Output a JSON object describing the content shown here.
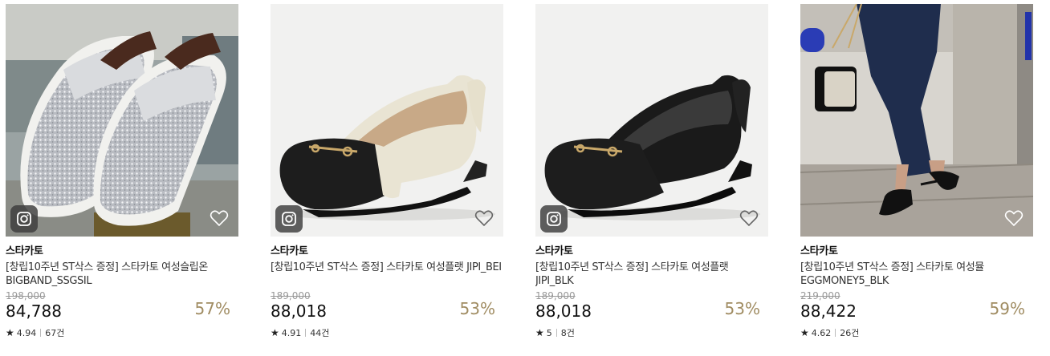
{
  "products": [
    {
      "brand": "스타카토",
      "title": "[창립10주년 ST삭스 증정] 스타카토 여성슬립온 BIGBAND_SSGSIL",
      "original_price": "198,000",
      "price": "84,788",
      "discount": "57%",
      "rating": "4.94",
      "reviews": "67건",
      "image": "silver-glitter-slip-on"
    },
    {
      "brand": "스타카토",
      "title": "[창립10주년 ST삭스 증정] 스타카토 여성플랫 JIPI_BEI",
      "original_price": "189,000",
      "price": "88,018",
      "discount": "53%",
      "rating": "4.91",
      "reviews": "44건",
      "image": "beige-flat-black-toe"
    },
    {
      "brand": "스타카토",
      "title": "[창립10주년 ST삭스 증정] 스타카토 여성플랫 JIPI_BLK",
      "original_price": "189,000",
      "price": "88,018",
      "discount": "53%",
      "rating": "5",
      "reviews": "8건",
      "image": "black-flat"
    },
    {
      "brand": "스타카토",
      "title": "[창립10주년 ST삭스 증정] 스타카토 여성뮬 EGGMONEY5_BLK",
      "original_price": "219,000",
      "price": "88,422",
      "discount": "59%",
      "rating": "4.62",
      "reviews": "26건",
      "image": "black-mule-street-photo"
    }
  ],
  "icons": {
    "instagram": "instagram-icon",
    "wishlist": "heart-outline-icon",
    "rating": "star-icon"
  },
  "colors": {
    "discount": "#a08c62",
    "strike_price": "#999999",
    "text": "#111111"
  }
}
